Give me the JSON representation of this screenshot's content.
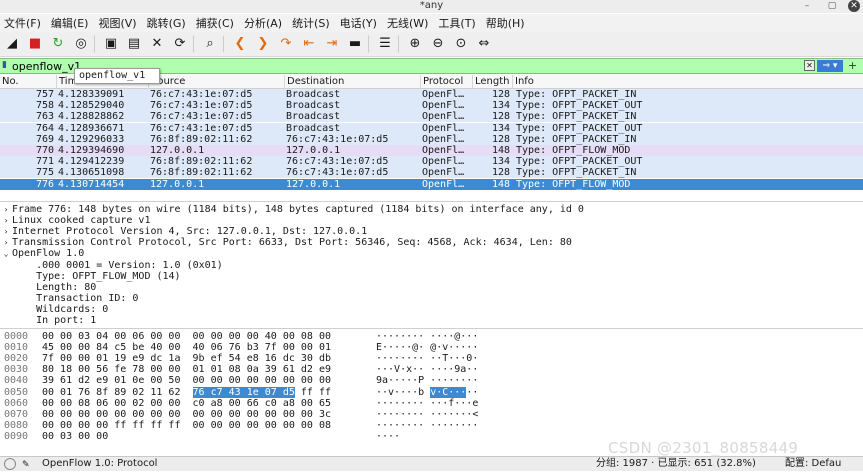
{
  "window": {
    "title": "*any"
  },
  "menu": [
    "文件(F)",
    "编辑(E)",
    "视图(V)",
    "跳转(G)",
    "捕获(C)",
    "分析(A)",
    "统计(S)",
    "电话(Y)",
    "无线(W)",
    "工具(T)",
    "帮助(H)"
  ],
  "toolbar": {
    "icons": [
      "shark-fin-start-icon",
      "stop-capture-icon",
      "restart-capture-icon",
      "capture-options-icon",
      "open-file-icon",
      "save-file-icon",
      "close-file-icon",
      "reload-file-icon",
      "find-packet-icon",
      "go-back-icon",
      "go-forward-icon",
      "go-to-packet-icon",
      "first-packet-icon",
      "last-packet-icon",
      "autoscroll-icon",
      "colorize-icon",
      "zoom-in-icon",
      "zoom-out-icon",
      "normal-size-icon",
      "resize-columns-icon"
    ],
    "glyphs": [
      "◢",
      "■",
      "↻",
      "◎",
      "▣",
      "▤",
      "✕",
      "⟳",
      "⌕",
      "❮",
      "❯",
      "↷",
      "⇤",
      "⇥",
      "▬",
      "☰",
      "⊕",
      "⊖",
      "⊙",
      "⇔"
    ],
    "colors": {
      "stop": "#d42020",
      "arrows": "#e06a10",
      "restart": "#2aa32a"
    }
  },
  "filter": {
    "value": "openflow_v1",
    "autocomplete": "openflow_v1",
    "apply_glyph": "⇒ ▾",
    "clear_glyph": "✕",
    "add_glyph": "+"
  },
  "packet_list": {
    "columns": [
      "No.",
      "Time",
      "Source",
      "Destination",
      "Protocol",
      "Length",
      "Info"
    ],
    "rows": [
      {
        "no": "757",
        "time": "4.128339091",
        "src": "76:c7:43:1e:07:d5",
        "dst": "Broadcast",
        "proto": "OpenFl…",
        "len": "128",
        "info": "Type: OFPT_PACKET_IN"
      },
      {
        "no": "758",
        "time": "4.128529040",
        "src": "76:c7:43:1e:07:d5",
        "dst": "Broadcast",
        "proto": "OpenFl…",
        "len": "134",
        "info": "Type: OFPT_PACKET_OUT"
      },
      {
        "no": "763",
        "time": "4.128828862",
        "src": "76:c7:43:1e:07:d5",
        "dst": "Broadcast",
        "proto": "OpenFl…",
        "len": "128",
        "info": "Type: OFPT_PACKET_IN"
      },
      {
        "no": "764",
        "time": "4.128936671",
        "src": "76:c7:43:1e:07:d5",
        "dst": "Broadcast",
        "proto": "OpenFl…",
        "len": "134",
        "info": "Type: OFPT_PACKET_OUT"
      },
      {
        "no": "769",
        "time": "4.129296033",
        "src": "76:8f:89:02:11:62",
        "dst": "76:c7:43:1e:07:d5",
        "proto": "OpenFl…",
        "len": "128",
        "info": "Type: OFPT_PACKET_IN"
      },
      {
        "no": "770",
        "time": "4.129394690",
        "src": "127.0.0.1",
        "dst": "127.0.0.1",
        "proto": "OpenFl…",
        "len": "148",
        "info": "Type: OFPT_FLOW_MOD"
      },
      {
        "no": "771",
        "time": "4.129412239",
        "src": "76:8f:89:02:11:62",
        "dst": "76:c7:43:1e:07:d5",
        "proto": "OpenFl…",
        "len": "134",
        "info": "Type: OFPT_PACKET_OUT"
      },
      {
        "no": "775",
        "time": "4.130651098",
        "src": "76:8f:89:02:11:62",
        "dst": "76:c7:43:1e:07:d5",
        "proto": "OpenFl…",
        "len": "128",
        "info": "Type: OFPT_PACKET_IN"
      },
      {
        "no": "776",
        "time": "4.130714454",
        "src": "127.0.0.1",
        "dst": "127.0.0.1",
        "proto": "OpenFl…",
        "len": "148",
        "info": "Type: OFPT_FLOW_MOD"
      }
    ],
    "row_colors": [
      "#dde9f9",
      "#dde9f9",
      "#dde9f9",
      "#dde9f9",
      "#dde9f9",
      "#e6dcf5",
      "#dde9f9",
      "#dde9f9",
      "#3a8ad4"
    ]
  },
  "details": [
    {
      "arrow": "›",
      "text": "Frame 776: 148 bytes on wire (1184 bits), 148 bytes captured (1184 bits) on interface any, id 0"
    },
    {
      "arrow": "›",
      "text": "Linux cooked capture v1"
    },
    {
      "arrow": "›",
      "text": "Internet Protocol Version 4, Src: 127.0.0.1, Dst: 127.0.0.1"
    },
    {
      "arrow": "›",
      "text": "Transmission Control Protocol, Src Port: 6633, Dst Port: 56346, Seq: 4568, Ack: 4634, Len: 80"
    },
    {
      "arrow": "⌄",
      "text": "OpenFlow 1.0"
    },
    {
      "arrow": "",
      "text": "    .000 0001 = Version: 1.0 (0x01)"
    },
    {
      "arrow": "",
      "text": "    Type: OFPT_FLOW_MOD (14)"
    },
    {
      "arrow": "",
      "text": "    Length: 80"
    },
    {
      "arrow": "",
      "text": "    Transaction ID: 0"
    },
    {
      "arrow": "",
      "text": "    Wildcards: 0"
    },
    {
      "arrow": "",
      "text": "    In port: 1"
    }
  ],
  "hex": [
    {
      "off": "0000",
      "pre": "00 00 03 04 00 06 00 00  00 00 00 00 40 00 08 00",
      "hl": "",
      "post": "",
      "ascii_pre": "········ ····@···",
      "ascii_hl": "",
      "ascii_post": ""
    },
    {
      "off": "0010",
      "pre": "45 00 00 84 c5 be 40 00  40 06 76 b3 7f 00 00 01",
      "hl": "",
      "post": "",
      "ascii_pre": "E·····@· @·v·····",
      "ascii_hl": "",
      "ascii_post": ""
    },
    {
      "off": "0020",
      "pre": "7f 00 00 01 19 e9 dc 1a  9b ef 54 e8 16 dc 30 db",
      "hl": "",
      "post": "",
      "ascii_pre": "········ ··T···0·",
      "ascii_hl": "",
      "ascii_post": ""
    },
    {
      "off": "0030",
      "pre": "80 18 00 56 fe 78 00 00  01 01 08 0a 39 61 d2 e9",
      "hl": "",
      "post": "",
      "ascii_pre": "···V·x·· ····9a··",
      "ascii_hl": "",
      "ascii_post": ""
    },
    {
      "off": "0040",
      "pre": "39 61 d2 e9 01 0e 00 50  00 00 00 00 00 00 00 00",
      "hl": "",
      "post": "",
      "ascii_pre": "9a·····P ········",
      "ascii_hl": "",
      "ascii_post": ""
    },
    {
      "off": "0050",
      "pre": "00 01 76 8f 89 02 11 62  ",
      "hl": "76 c7 43 1e 07 d5",
      "post": " ff ff",
      "ascii_pre": "··v····b ",
      "ascii_hl": "v·C···",
      "ascii_post": "··"
    },
    {
      "off": "0060",
      "pre": "00 00 08 06 00 02 00 00  c0 a8 00 66 c0 a8 00 65",
      "hl": "",
      "post": "",
      "ascii_pre": "········ ···f···e",
      "ascii_hl": "",
      "ascii_post": ""
    },
    {
      "off": "0070",
      "pre": "00 00 00 00 00 00 00 00  00 00 00 00 00 00 00 3c",
      "hl": "",
      "post": "",
      "ascii_pre": "········ ·······<",
      "ascii_hl": "",
      "ascii_post": ""
    },
    {
      "off": "0080",
      "pre": "00 00 00 00 ff ff ff ff  00 00 00 00 00 00 00 08",
      "hl": "",
      "post": "",
      "ascii_pre": "········ ········",
      "ascii_hl": "",
      "ascii_post": ""
    },
    {
      "off": "0090",
      "pre": "00 03 00 00",
      "hl": "",
      "post": "",
      "ascii_pre": "····",
      "ascii_hl": "",
      "ascii_post": ""
    }
  ],
  "status": {
    "left": "OpenFlow 1.0: Protocol",
    "right": "分组: 1987 · 已显示: 651 (32.8%)",
    "profile": "配置: Defau"
  },
  "watermark": "CSDN @2301_80858449"
}
